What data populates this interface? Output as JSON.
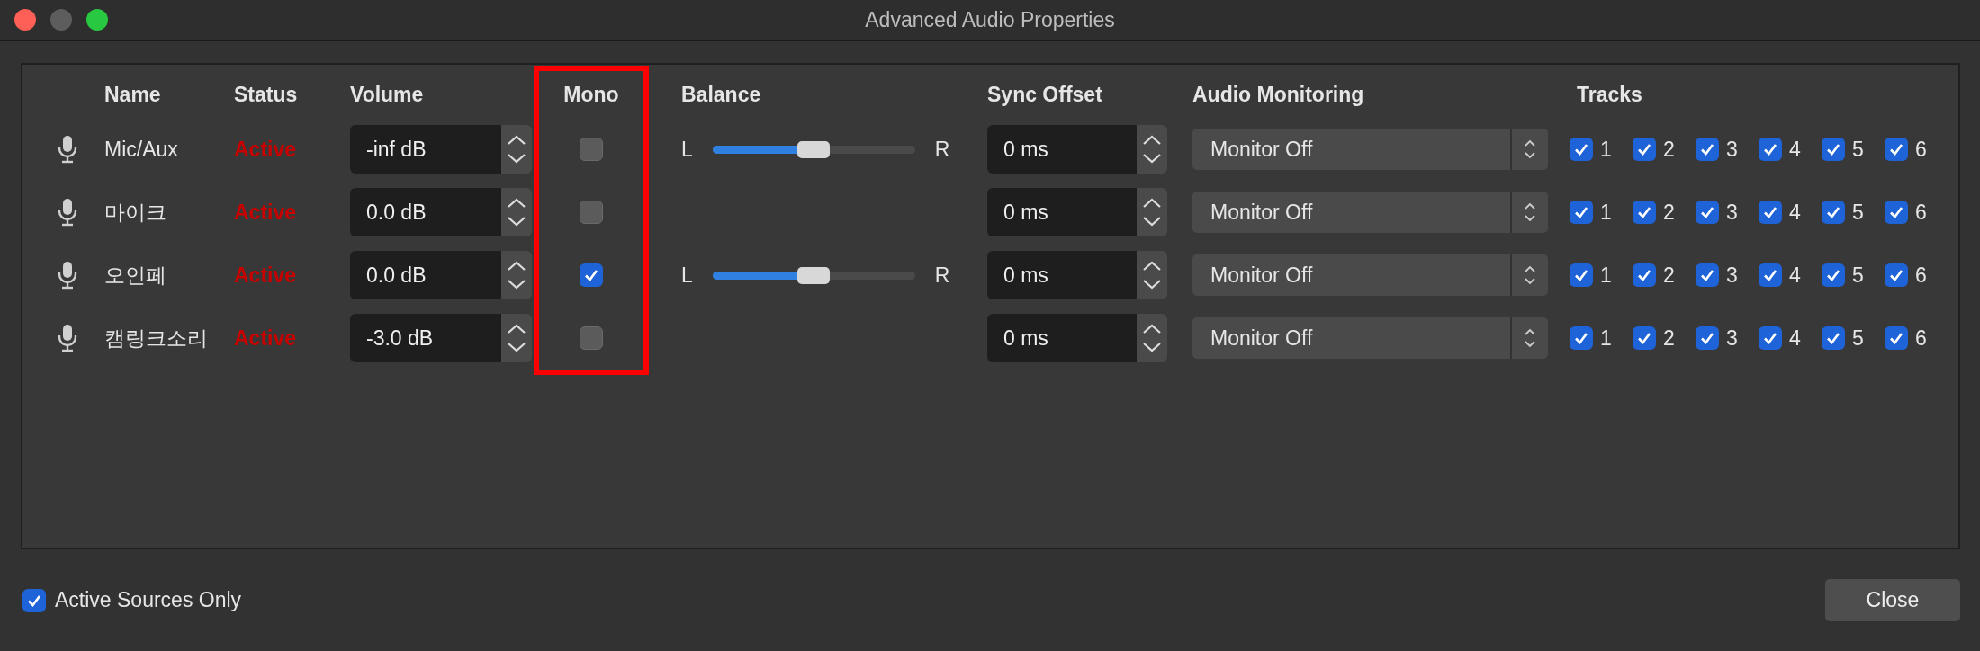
{
  "window": {
    "title": "Advanced Audio Properties"
  },
  "columns": [
    {
      "kind": "name",
      "label": "Name",
      "highlighted": false
    },
    {
      "kind": "status",
      "label": "Status",
      "highlighted": false
    },
    {
      "kind": "volume",
      "label": "Volume",
      "highlighted": false
    },
    {
      "kind": "mono",
      "label": "Mono",
      "highlighted": true
    },
    {
      "kind": "balance",
      "label": "Balance",
      "highlighted": false
    },
    {
      "kind": "sync",
      "label": "Sync Offset",
      "highlighted": false
    },
    {
      "kind": "monitoring",
      "label": "Audio Monitoring",
      "highlighted": false
    },
    {
      "kind": "tracks",
      "label": "Tracks",
      "highlighted": false
    }
  ],
  "sources": [
    {
      "name": "Mic/Aux",
      "status": "Active",
      "volume": "-inf dB",
      "mono": false,
      "balance": {
        "left": "L",
        "right": "R",
        "level": 0.5
      },
      "sync_offset": "0 ms",
      "monitoring": "Monitor Off",
      "tracks": [
        {
          "label": "1",
          "checked": true
        },
        {
          "label": "2",
          "checked": true
        },
        {
          "label": "3",
          "checked": true
        },
        {
          "label": "4",
          "checked": true
        },
        {
          "label": "5",
          "checked": true
        },
        {
          "label": "6",
          "checked": true
        }
      ]
    },
    {
      "name": "마이크",
      "status": "Active",
      "volume": "0.0 dB",
      "mono": false,
      "sync_offset": "0 ms",
      "monitoring": "Monitor Off",
      "tracks": [
        {
          "label": "1",
          "checked": true
        },
        {
          "label": "2",
          "checked": true
        },
        {
          "label": "3",
          "checked": true
        },
        {
          "label": "4",
          "checked": true
        },
        {
          "label": "5",
          "checked": true
        },
        {
          "label": "6",
          "checked": true
        }
      ]
    },
    {
      "name": "오인페",
      "status": "Active",
      "volume": "0.0 dB",
      "mono": true,
      "balance": {
        "left": "L",
        "right": "R",
        "level": 0.5
      },
      "sync_offset": "0 ms",
      "monitoring": "Monitor Off",
      "tracks": [
        {
          "label": "1",
          "checked": true
        },
        {
          "label": "2",
          "checked": true
        },
        {
          "label": "3",
          "checked": true
        },
        {
          "label": "4",
          "checked": true
        },
        {
          "label": "5",
          "checked": true
        },
        {
          "label": "6",
          "checked": true
        }
      ]
    },
    {
      "name": "캠링크소리",
      "status": "Active",
      "volume": "-3.0 dB",
      "mono": false,
      "sync_offset": "0 ms",
      "monitoring": "Monitor Off",
      "tracks": [
        {
          "label": "1",
          "checked": true
        },
        {
          "label": "2",
          "checked": true
        },
        {
          "label": "3",
          "checked": true
        },
        {
          "label": "4",
          "checked": true
        },
        {
          "label": "5",
          "checked": true
        },
        {
          "label": "6",
          "checked": true
        }
      ]
    }
  ],
  "active_sources_only": {
    "label": "Active Sources Only",
    "checked": true
  },
  "close_button": "Close"
}
